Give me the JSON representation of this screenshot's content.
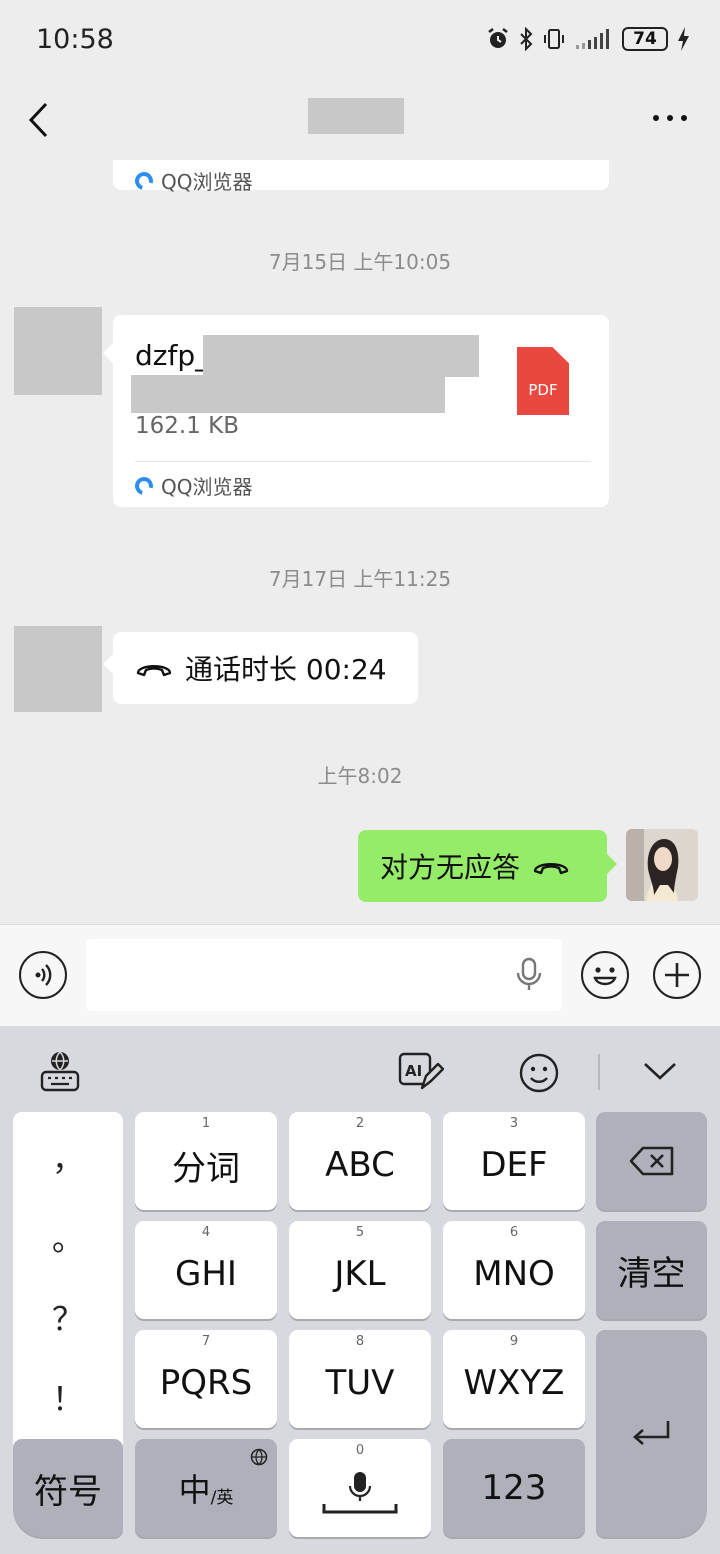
{
  "status": {
    "time": "10:58",
    "battery": "74"
  },
  "messages": {
    "prev_file_source": "QQ浏览器",
    "time1": "7月15日 上午10:05",
    "file": {
      "name_prefix": "dzfp_",
      "size": "162.1 KB",
      "type_label": "PDF",
      "source": "QQ浏览器"
    },
    "time2": "7月17日 上午11:25",
    "call_in": "通话时长 00:24",
    "time3": "上午8:02",
    "call_out": "对方无应答"
  },
  "keyboard": {
    "punct": [
      "，",
      "。",
      "？",
      "！"
    ],
    "rows": [
      [
        {
          "num": "1",
          "label": "分词"
        },
        {
          "num": "2",
          "label": "ABC"
        },
        {
          "num": "3",
          "label": "DEF"
        }
      ],
      [
        {
          "num": "4",
          "label": "GHI"
        },
        {
          "num": "5",
          "label": "JKL"
        },
        {
          "num": "6",
          "label": "MNO"
        }
      ],
      [
        {
          "num": "7",
          "label": "PQRS"
        },
        {
          "num": "8",
          "label": "TUV"
        },
        {
          "num": "9",
          "label": "WXYZ"
        }
      ]
    ],
    "clear": "清空",
    "symbols": "符号",
    "lang_main": "中",
    "lang_sub": "/英",
    "space_num": "0",
    "numbers": "123"
  },
  "colors": {
    "green_bubble": "#95ec69",
    "pdf_red": "#e8483f",
    "qq_blue": "#2b8ef2"
  }
}
